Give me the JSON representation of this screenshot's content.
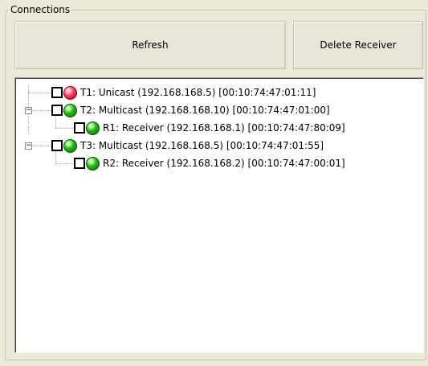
{
  "window": {
    "group_title": "Connections",
    "refresh_label": "Refresh",
    "delete_label": "Delete Receiver"
  },
  "tree": {
    "nodes": [
      {
        "label": "T1: Unicast (192.168.168.5) [00:10:74:47:01:11]",
        "status": "red",
        "expander": ""
      },
      {
        "label": "T2: Multicast (192.168.168.10) [00:10:74:47:01:00]",
        "status": "green",
        "expander": "−"
      },
      {
        "label": "R1: Receiver (192.168.168.1) [00:10:74:47:80:09]",
        "status": "green",
        "expander": ""
      },
      {
        "label": "T3: Multicast (192.168.168.5) [00:10:74:47:01:55]",
        "status": "green",
        "expander": "−"
      },
      {
        "label": "R2: Receiver (192.168.168.2) [00:10:74:47:00:01]",
        "status": "green",
        "expander": ""
      }
    ]
  },
  "colors": {
    "background": "#ece9d8",
    "status_green": "#22b414",
    "status_red": "#f04060"
  }
}
